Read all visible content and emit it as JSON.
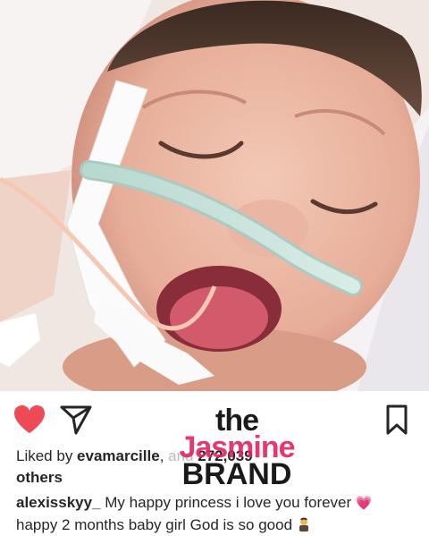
{
  "post": {
    "image_alt": "smiling newborn baby with nasal cannula",
    "actions": {
      "like_icon": "heart-icon",
      "share_icon": "send-icon",
      "save_icon": "bookmark-icon",
      "like_color": "#ed4956"
    },
    "likes": {
      "prefix": "Liked by ",
      "user": "evamarcille",
      "middle": ", ",
      "obscured": "and",
      "count": "272,039",
      "suffix": "others"
    },
    "caption": {
      "user": "alexisskyy_",
      "text": " My happy princess i love you forever ",
      "text2": "happy 2 months baby girl God is so good "
    }
  },
  "watermark": {
    "line1": "the",
    "line2": "Jasmine",
    "line3": "BRAND"
  }
}
